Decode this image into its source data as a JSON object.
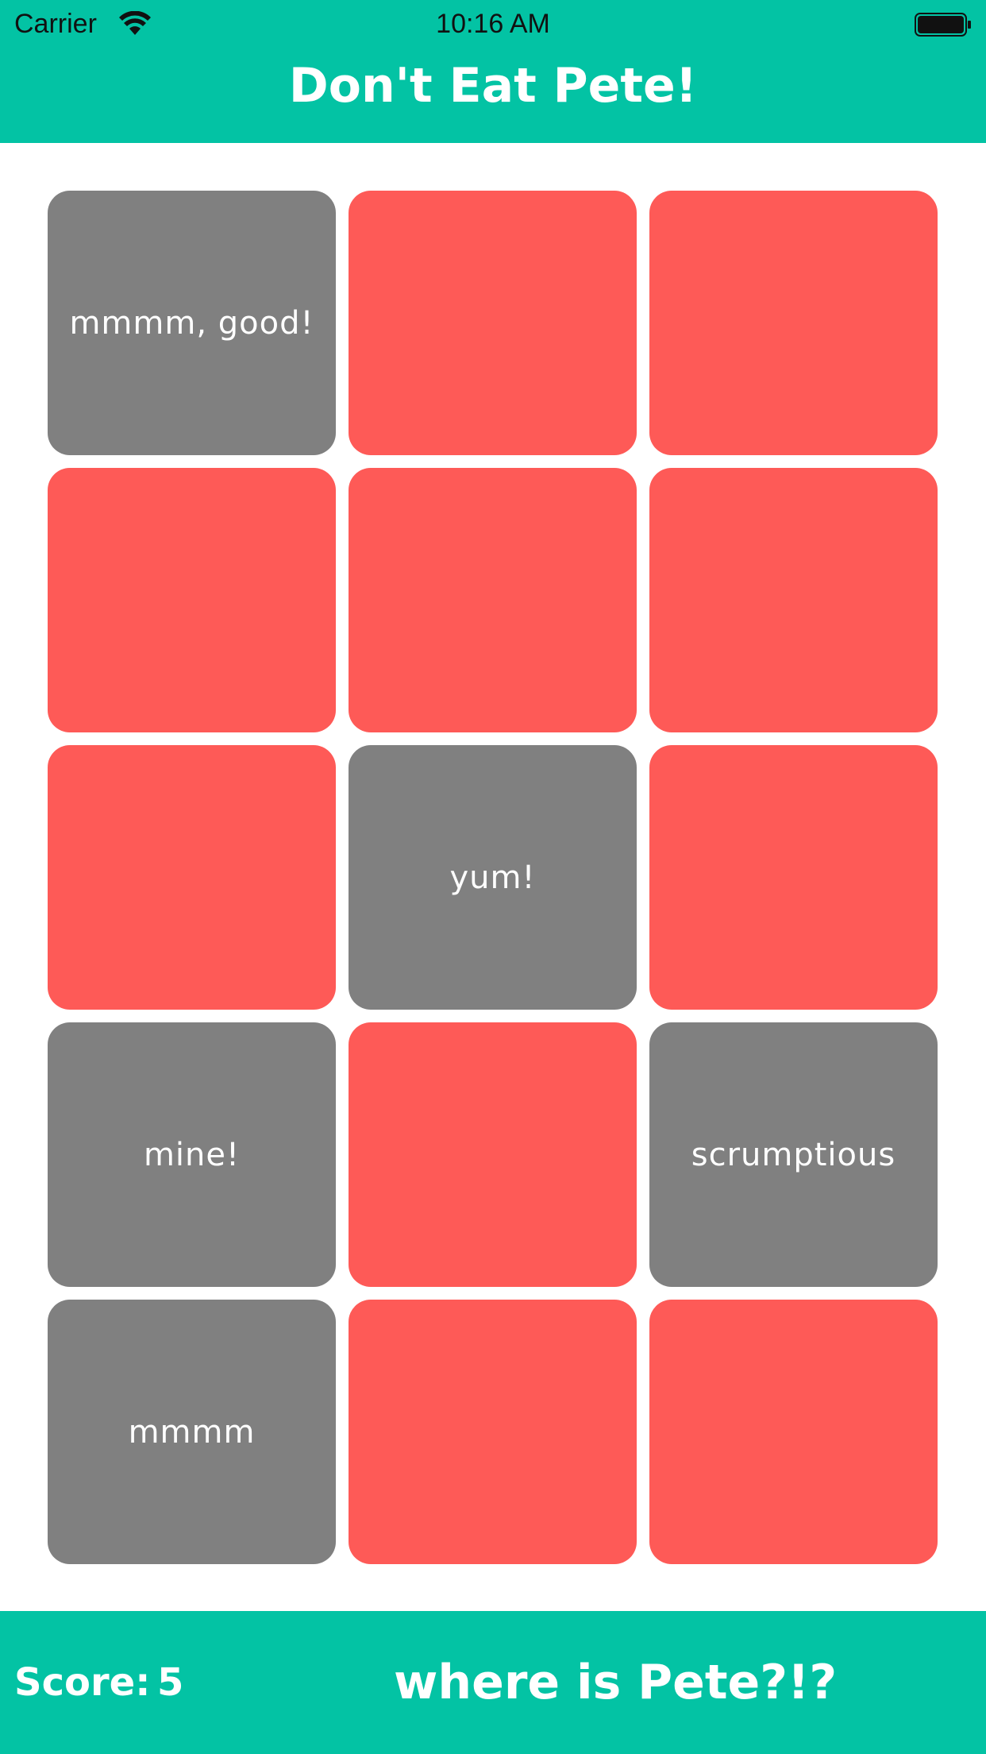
{
  "status_bar": {
    "carrier": "Carrier",
    "time": "10:16 AM",
    "wifi_icon": "wifi-icon",
    "battery_icon": "battery-icon"
  },
  "header": {
    "title": "Don't Eat Pete!",
    "background_color": "#03c3a4"
  },
  "board": {
    "rows": 5,
    "columns": 3,
    "tiles": [
      {
        "state": "revealed",
        "label": "mmmm, good!"
      },
      {
        "state": "hidden",
        "label": ""
      },
      {
        "state": "hidden",
        "label": ""
      },
      {
        "state": "hidden",
        "label": ""
      },
      {
        "state": "hidden",
        "label": ""
      },
      {
        "state": "hidden",
        "label": ""
      },
      {
        "state": "hidden",
        "label": ""
      },
      {
        "state": "revealed",
        "label": "yum!"
      },
      {
        "state": "hidden",
        "label": ""
      },
      {
        "state": "revealed",
        "label": "mine!"
      },
      {
        "state": "hidden",
        "label": ""
      },
      {
        "state": "revealed",
        "label": "scrumptious"
      },
      {
        "state": "revealed",
        "label": "mmmm"
      },
      {
        "state": "hidden",
        "label": ""
      },
      {
        "state": "hidden",
        "label": ""
      }
    ],
    "hidden_color": "#fe5a57",
    "revealed_color": "#808080"
  },
  "footer": {
    "score_label": "Score:",
    "score_value": "5",
    "message": "where is Pete?!?"
  }
}
